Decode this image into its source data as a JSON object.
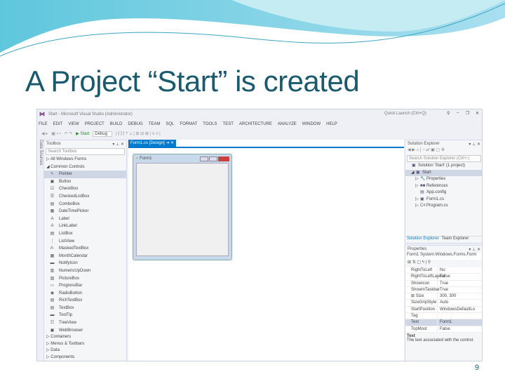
{
  "slide": {
    "title": "A Project “Start” is created",
    "page_number": "9"
  },
  "vs": {
    "window_title": "Start - Microsoft Visual Studio (Administrator)",
    "quick_launch": "Quick Launch (Ctrl+Q)",
    "menu": [
      "FILE",
      "EDIT",
      "VIEW",
      "PROJECT",
      "BUILD",
      "DEBUG",
      "TEAM",
      "SQL",
      "FORMAT",
      "TOOLS",
      "TEST",
      "ARCHITECTURE",
      "ANALYZE",
      "WINDOW",
      "HELP"
    ],
    "toolbar": {
      "start": "▶ Start",
      "config": "Debug"
    },
    "data_sources": "Data Sources",
    "toolbox": {
      "title": "Toolbox",
      "search": "Search Toolbox",
      "groups_top": [
        "▷ All Windows Forms",
        "◢ Common Controls"
      ],
      "items": [
        [
          "↖",
          "Pointer"
        ],
        [
          "▣",
          "Button"
        ],
        [
          "☑",
          "CheckBox"
        ],
        [
          "☰",
          "CheckedListBox"
        ],
        [
          "▤",
          "ComboBox"
        ],
        [
          "▦",
          "DateTimePicker"
        ],
        [
          "A",
          "Label"
        ],
        [
          "A",
          "LinkLabel"
        ],
        [
          "▤",
          "ListBox"
        ],
        [
          "⋮",
          "ListView"
        ],
        [
          "#-",
          "MaskedTextBox"
        ],
        [
          "▦",
          "MonthCalendar"
        ],
        [
          "▬",
          "NotifyIcon"
        ],
        [
          "▥",
          "NumericUpDown"
        ],
        [
          "▧",
          "PictureBox"
        ],
        [
          "▭",
          "ProgressBar"
        ],
        [
          "◉",
          "RadioButton"
        ],
        [
          "▤",
          "RichTextBox"
        ],
        [
          "▤",
          "TextBox"
        ],
        [
          "▬",
          "ToolTip"
        ],
        [
          "☷",
          "TreeView"
        ],
        [
          "▣",
          "WebBrowser"
        ]
      ],
      "groups_bottom": [
        "▷ Containers",
        "▷ Menus & Toolbars",
        "▷ Data",
        "▷ Components"
      ]
    },
    "designer": {
      "tab": "Form1.cs [Design]",
      "form_title": "Form1"
    },
    "solution_explorer": {
      "title": "Solution Explorer",
      "search": "Search Solution Explorer (Ctrl+;)",
      "items": [
        [
          "",
          "▣",
          "Solution 'Start' (1 project)"
        ],
        [
          "◢",
          "▣",
          "Start"
        ],
        [
          "▷",
          "🔧",
          "Properties"
        ],
        [
          "▷",
          "■■",
          "References"
        ],
        [
          "",
          "▤",
          "App.config"
        ],
        [
          "▷",
          "▣",
          "Form1.cs"
        ],
        [
          "▷",
          "C#",
          "Program.cs"
        ]
      ],
      "tabs": [
        "Solution Explorer",
        "Team Explorer"
      ]
    },
    "properties": {
      "title": "Properties",
      "object": "Form1 System.Windows.Forms.Form",
      "rows": [
        [
          "RightToLeft",
          "No"
        ],
        [
          "RightToLeftLayout",
          "False"
        ],
        [
          "ShowIcon",
          "True"
        ],
        [
          "ShowInTaskbar",
          "True"
        ],
        [
          "⊞ Size",
          "300, 300"
        ],
        [
          "SizeGripStyle",
          "Auto"
        ],
        [
          "StartPosition",
          "WindowsDefaultLo"
        ],
        [
          "Tag",
          ""
        ],
        [
          "Text",
          "Form1"
        ],
        [
          "TopMost",
          "False"
        ]
      ],
      "desc_title": "Text",
      "desc": "The text associated with the control."
    }
  }
}
